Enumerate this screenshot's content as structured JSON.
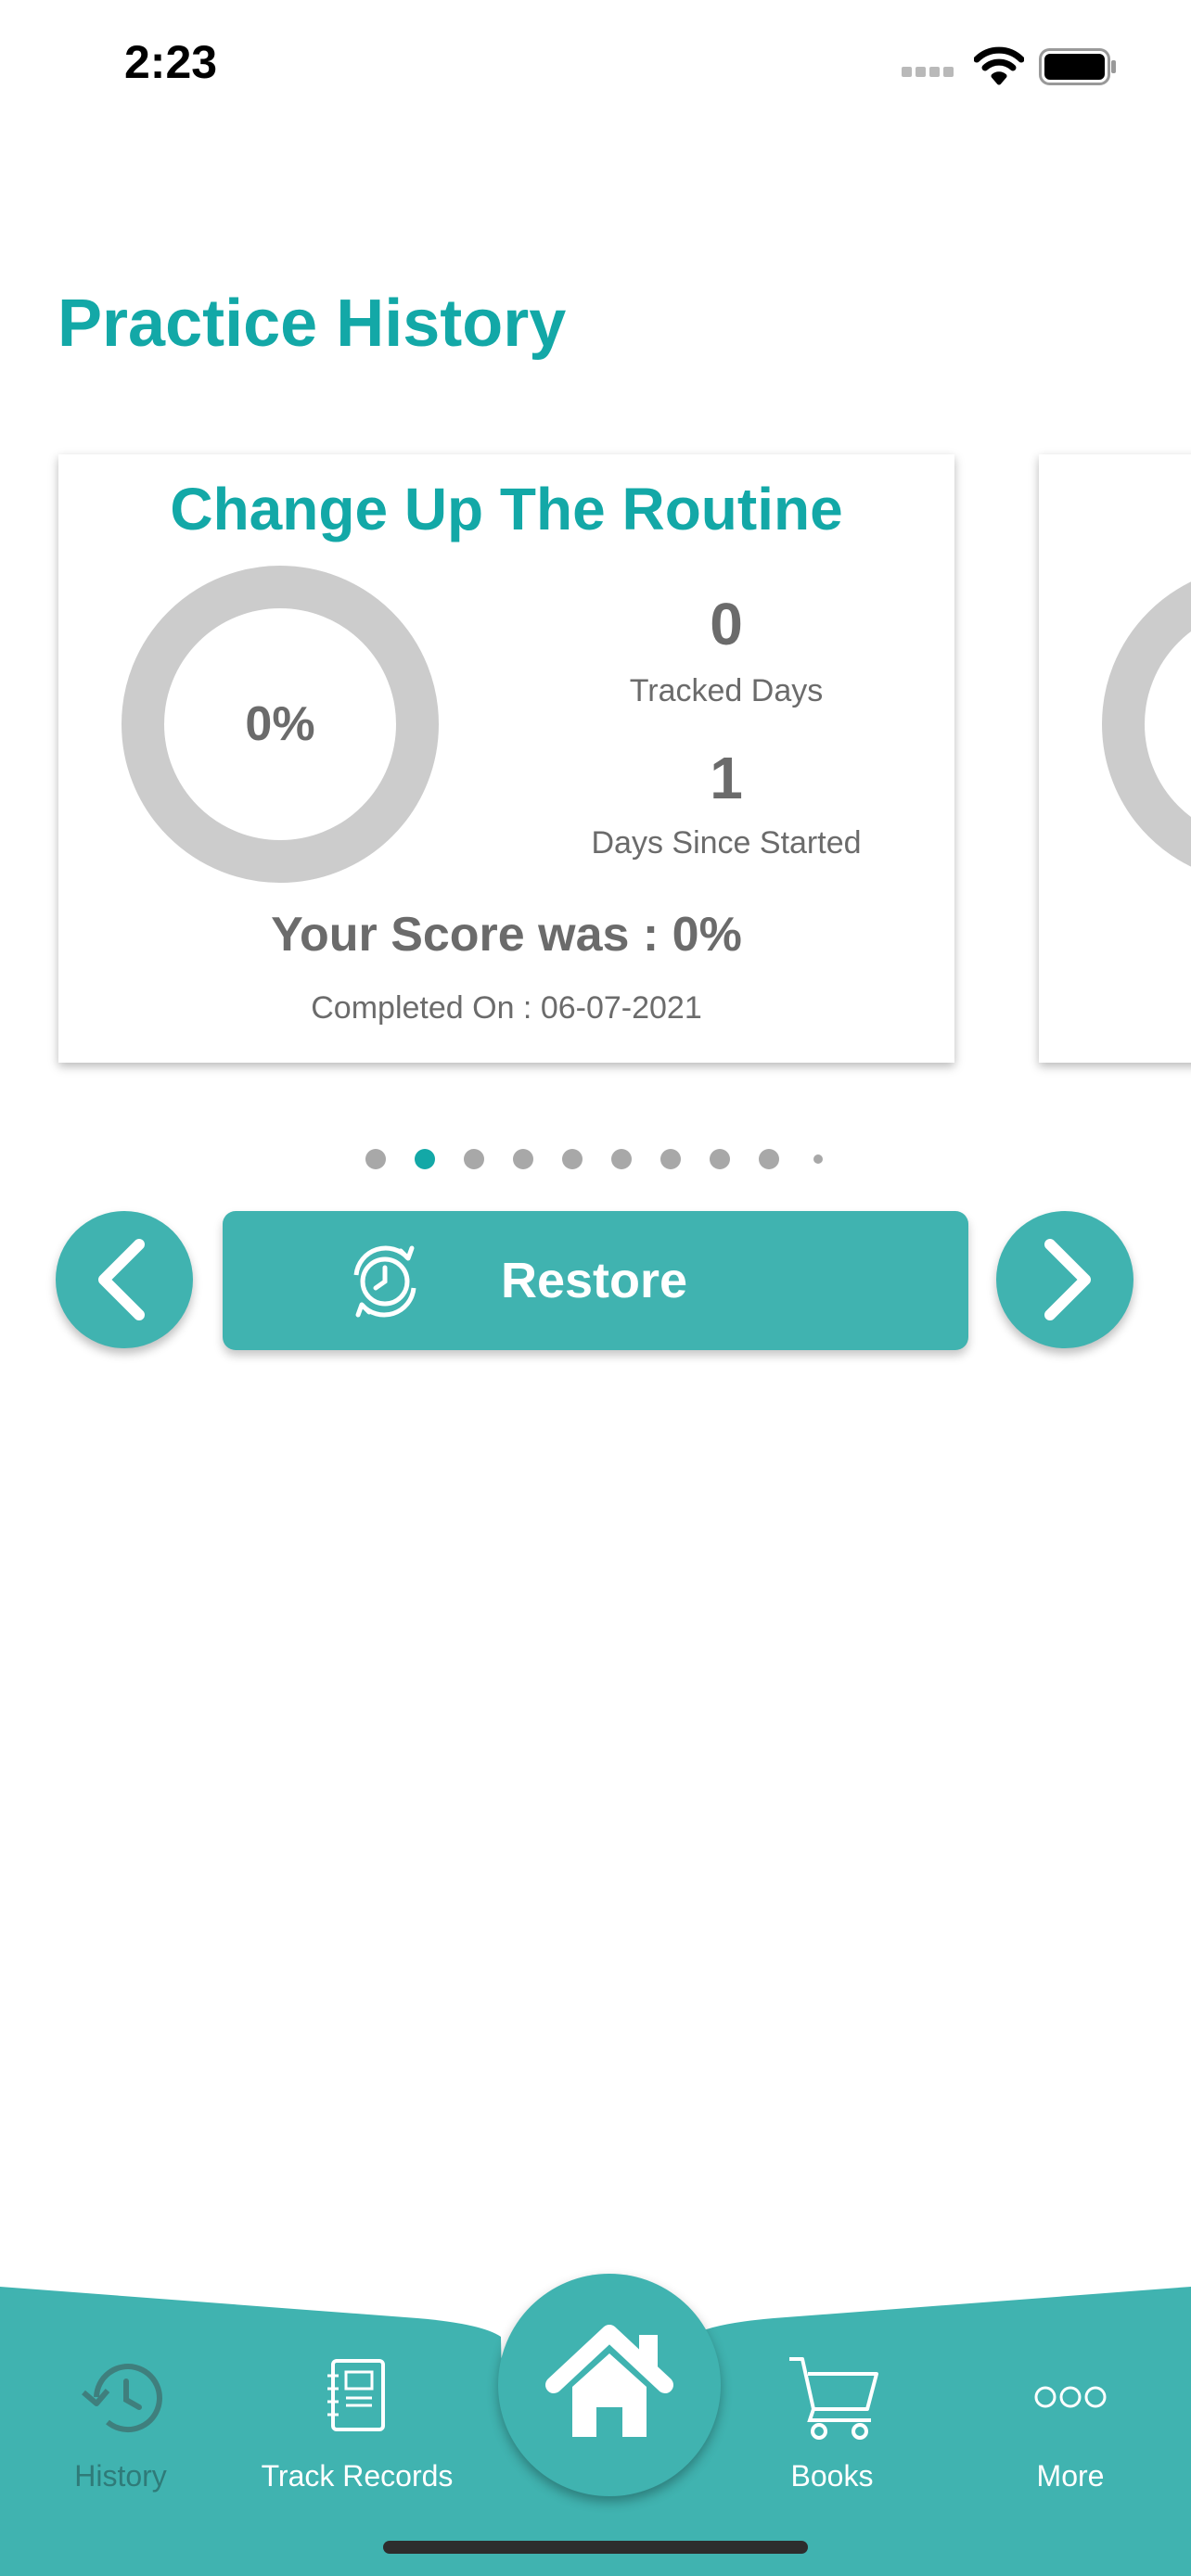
{
  "status_bar": {
    "time": "2:23"
  },
  "header": {
    "title": "Practice History"
  },
  "card": {
    "name": "Change Up The Routine",
    "progress_percent": 0,
    "progress_label": "0%",
    "tracked_days_value": "0",
    "tracked_days_label": "Tracked Days",
    "days_since_value": "1",
    "days_since_label": "Days Since Started",
    "score_text": "Your Score was : 0%",
    "completed_text": "Completed On : 06-07-2021"
  },
  "pager": {
    "total": 10,
    "active_index": 1
  },
  "actions": {
    "restore_label": "Restore"
  },
  "tabbar": {
    "items": [
      {
        "label": "History",
        "icon": "history-icon"
      },
      {
        "label": "Track Records",
        "icon": "notebook-icon"
      },
      {
        "label": "",
        "icon": "home-icon"
      },
      {
        "label": "Books",
        "icon": "cart-icon"
      },
      {
        "label": "More",
        "icon": "more-icon"
      }
    ]
  },
  "colors": {
    "accent": "#13a8a7",
    "button": "#40b3b0",
    "text_gray": "#6b6b6b",
    "donut_track": "#cccccc"
  }
}
